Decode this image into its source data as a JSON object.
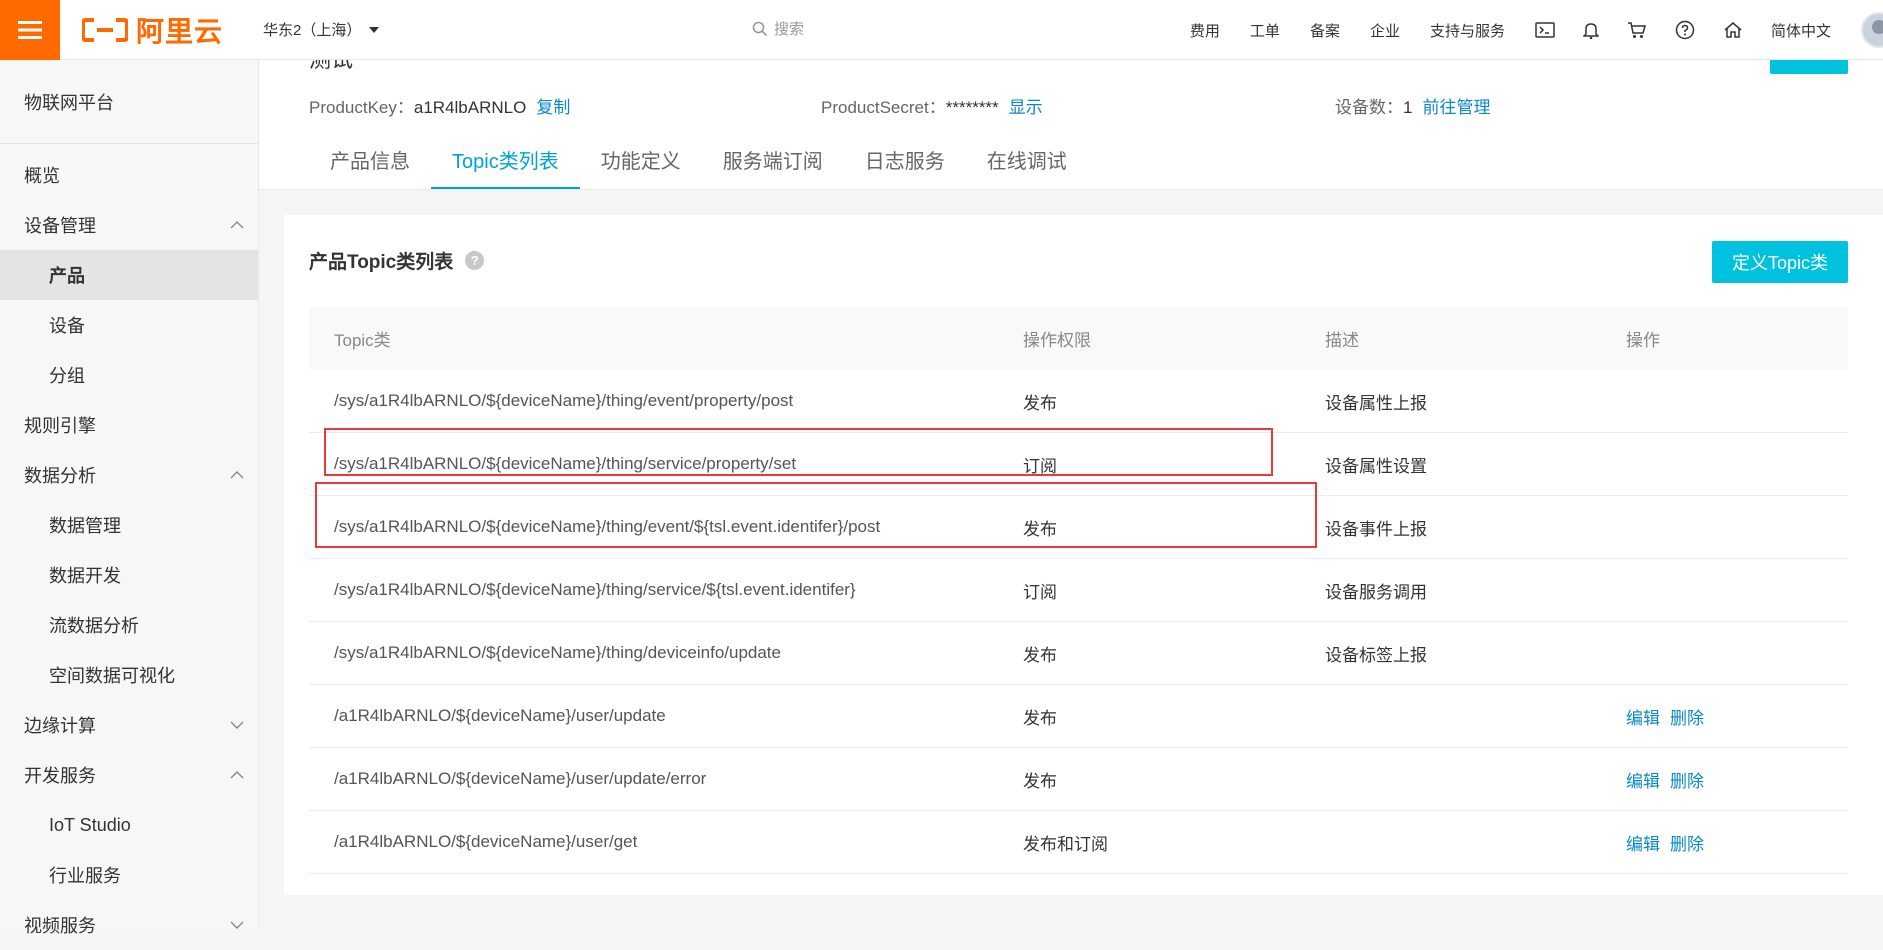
{
  "topbar": {
    "logo_text": "阿里云",
    "region": "华东2（上海）",
    "search_placeholder": "搜索",
    "links": [
      "费用",
      "工单",
      "备案",
      "企业",
      "支持与服务"
    ],
    "language": "简体中文",
    "brand_color": "#ff6a00"
  },
  "sidebar": {
    "title": "物联网平台",
    "items": [
      {
        "label": "概览",
        "sub": false,
        "caret": ""
      },
      {
        "label": "设备管理",
        "sub": false,
        "caret": "up"
      },
      {
        "label": "产品",
        "sub": true,
        "active": true
      },
      {
        "label": "设备",
        "sub": true
      },
      {
        "label": "分组",
        "sub": true
      },
      {
        "label": "规则引擎",
        "sub": false,
        "caret": ""
      },
      {
        "label": "数据分析",
        "sub": false,
        "caret": "up"
      },
      {
        "label": "数据管理",
        "sub": true
      },
      {
        "label": "数据开发",
        "sub": true
      },
      {
        "label": "流数据分析",
        "sub": true
      },
      {
        "label": "空间数据可视化",
        "sub": true
      },
      {
        "label": "边缘计算",
        "sub": false,
        "caret": "down"
      },
      {
        "label": "开发服务",
        "sub": false,
        "caret": "up"
      },
      {
        "label": "IoT Studio",
        "sub": true
      },
      {
        "label": "行业服务",
        "sub": true
      },
      {
        "label": "视频服务",
        "sub": false,
        "caret": "down"
      }
    ]
  },
  "product": {
    "name": "测试",
    "key_label": "ProductKey：",
    "key_value": "a1R4lbARNLO",
    "key_action": "复制",
    "secret_label": "ProductSecret：",
    "secret_value": "********",
    "secret_action": "显示",
    "device_count_label": "设备数：",
    "device_count_value": "1",
    "device_count_action": "前往管理"
  },
  "tabs": [
    {
      "label": "产品信息",
      "active": false
    },
    {
      "label": "Topic类列表",
      "active": true
    },
    {
      "label": "功能定义",
      "active": false
    },
    {
      "label": "服务端订阅",
      "active": false
    },
    {
      "label": "日志服务",
      "active": false
    },
    {
      "label": "在线调试",
      "active": false
    }
  ],
  "topic_section": {
    "title": "产品Topic类列表",
    "define_button": "定义Topic类",
    "accent_color": "#00c1de",
    "columns": [
      "Topic类",
      "操作权限",
      "描述",
      "操作"
    ],
    "rows": [
      {
        "topic": "/sys/a1R4lbARNLO/${deviceName}/thing/event/property/post",
        "perm": "发布",
        "desc": "设备属性上报",
        "ops": []
      },
      {
        "topic": "/sys/a1R4lbARNLO/${deviceName}/thing/service/property/set",
        "perm": "订阅",
        "desc": "设备属性设置",
        "ops": []
      },
      {
        "topic": "/sys/a1R4lbARNLO/${deviceName}/thing/event/${tsl.event.identifer}/post",
        "perm": "发布",
        "desc": "设备事件上报",
        "ops": []
      },
      {
        "topic": "/sys/a1R4lbARNLO/${deviceName}/thing/service/${tsl.event.identifer}",
        "perm": "订阅",
        "desc": "设备服务调用",
        "ops": []
      },
      {
        "topic": "/sys/a1R4lbARNLO/${deviceName}/thing/deviceinfo/update",
        "perm": "发布",
        "desc": "设备标签上报",
        "ops": []
      },
      {
        "topic": "/a1R4lbARNLO/${deviceName}/user/update",
        "perm": "发布",
        "desc": "",
        "ops": [
          "编辑",
          "删除"
        ]
      },
      {
        "topic": "/a1R4lbARNLO/${deviceName}/user/update/error",
        "perm": "发布",
        "desc": "",
        "ops": [
          "编辑",
          "删除"
        ]
      },
      {
        "topic": "/a1R4lbARNLO/${deviceName}/user/get",
        "perm": "发布和订阅",
        "desc": "",
        "ops": [
          "编辑",
          "删除"
        ]
      }
    ],
    "highlight_color": "#e83a3a"
  }
}
